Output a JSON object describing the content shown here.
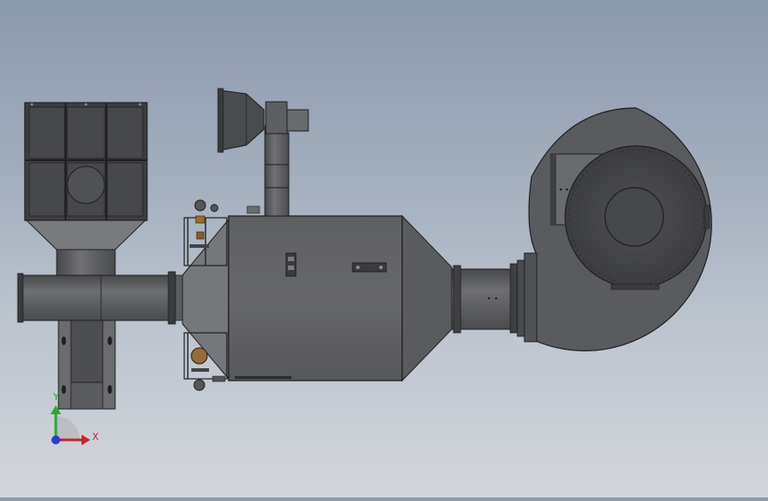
{
  "viewport": {
    "model_name": "",
    "background_top": "#8b99ad",
    "background_bottom": "#d2d6db",
    "body_color": "#5c5d5f",
    "body_dark": "#3e3f41",
    "edge_color": "#1e1f21"
  },
  "triad": {
    "x_label": "X",
    "y_label": "Y",
    "x_color": "#c2272d",
    "y_color": "#2fa33a",
    "z_color": "#2b3bd6"
  }
}
